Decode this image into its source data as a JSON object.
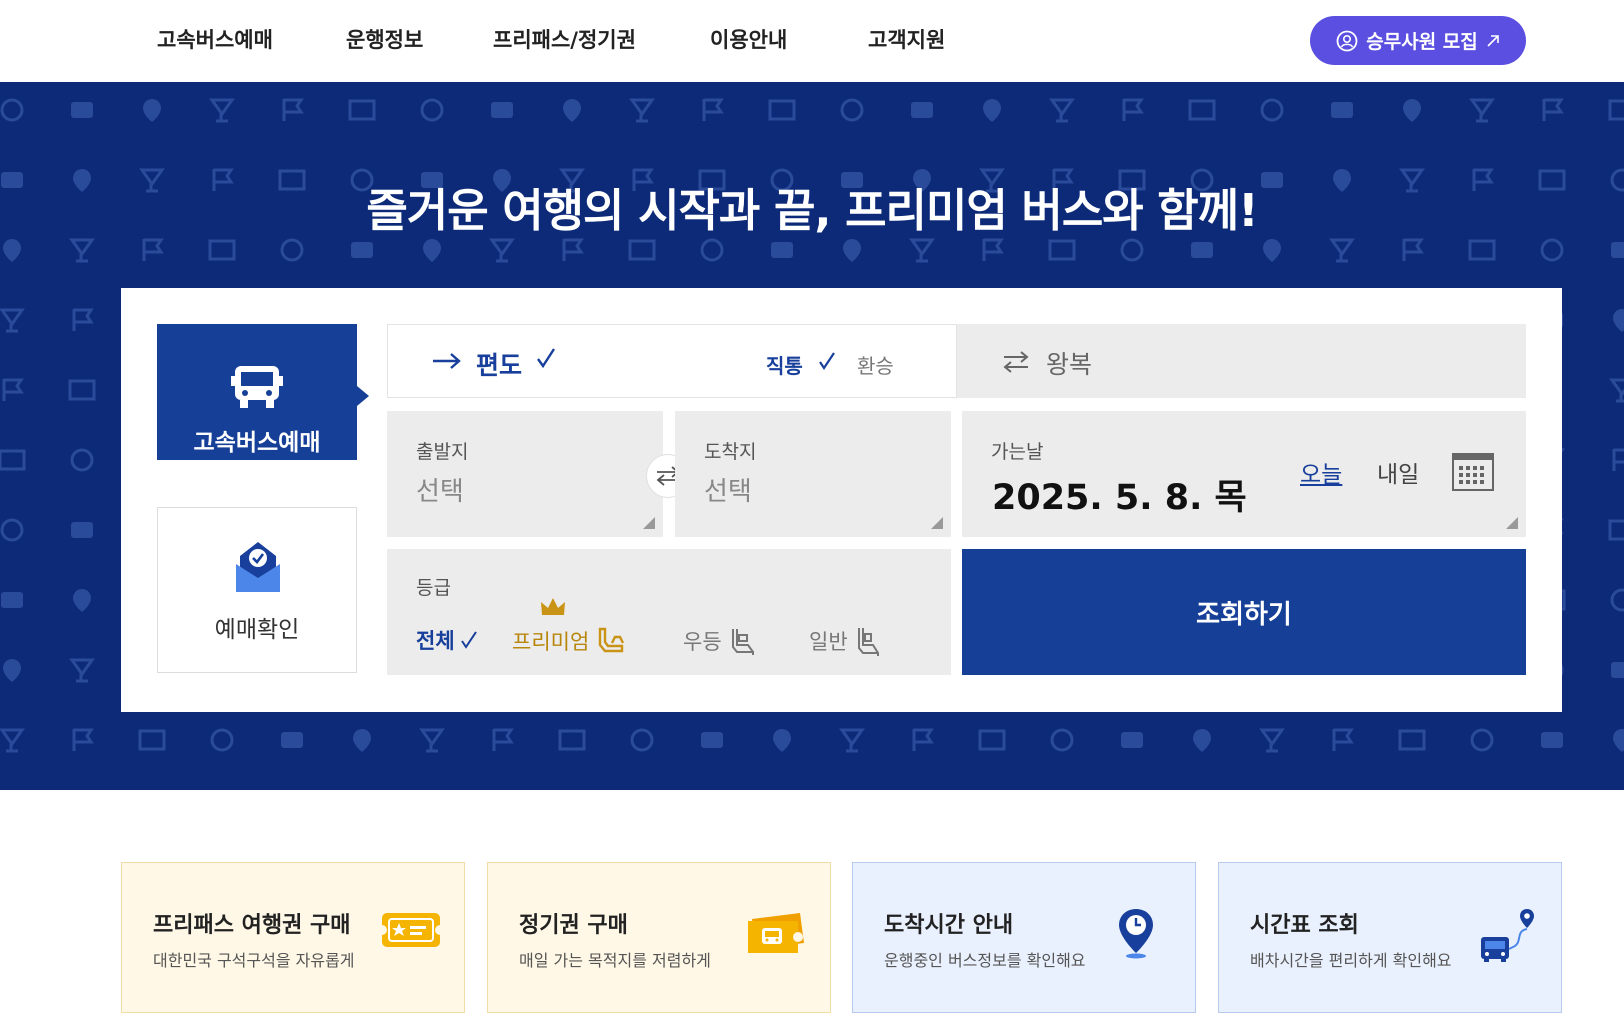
{
  "header": {
    "nav": [
      "고속버스예매",
      "운행정보",
      "프리패스/정기권",
      "이용안내",
      "고객지원"
    ],
    "recruit_label": "승무사원 모집"
  },
  "hero": {
    "title": "즐거운 여행의 시작과 끝, 프리미엄 버스와 함께!"
  },
  "booking": {
    "side_tabs": {
      "reserve": "고속버스예매",
      "confirm": "예매확인"
    },
    "trip_type": {
      "oneway": "편도",
      "direct": "직통",
      "transfer": "환승",
      "roundtrip": "왕복"
    },
    "departure": {
      "caption": "출발지",
      "value": "선택"
    },
    "arrival": {
      "caption": "도착지",
      "value": "선택"
    },
    "date": {
      "caption": "가는날",
      "value": "2025. 5. 8. 목",
      "today": "오늘",
      "tomorrow": "내일"
    },
    "grade": {
      "caption": "등급",
      "options": [
        "전체",
        "프리미엄",
        "우등",
        "일반"
      ],
      "selected": "전체"
    },
    "search_label": "조회하기"
  },
  "cards": [
    {
      "title": "프리패스 여행권 구매",
      "sub": "대한민국 구석구석을 자유롭게",
      "icon": "ticket-icon"
    },
    {
      "title": "정기권 구매",
      "sub": "매일 가는 목적지를 저렴하게",
      "icon": "bus-ticket-icon"
    },
    {
      "title": "도착시간 안내",
      "sub": "운행중인 버스정보를 확인해요",
      "icon": "location-clock-icon"
    },
    {
      "title": "시간표 조회",
      "sub": "배차시간을 편리하게 확인해요",
      "icon": "bus-route-icon"
    }
  ],
  "colors": {
    "primary": "#163f98",
    "hero_bg": "#0d2a78",
    "recruit": "#5a4fe0",
    "premium": "#b8860b"
  }
}
